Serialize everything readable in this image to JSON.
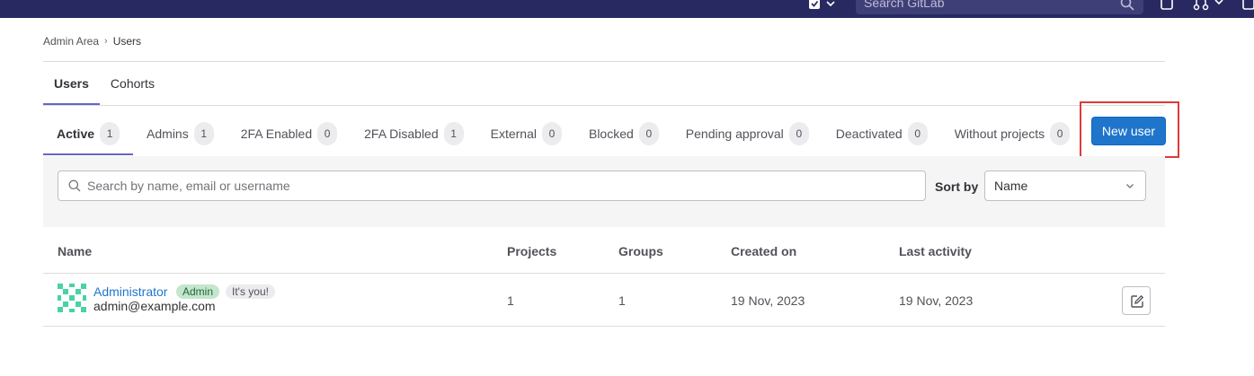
{
  "topbar": {
    "search_placeholder": "Search GitLab",
    "icons": [
      "issues-icon",
      "chevron-down-icon",
      "search-icon",
      "todo-icon",
      "merge-request-icon",
      "chevron-down-icon",
      "user-icon"
    ],
    "bg_color": "#292961"
  },
  "breadcrumb": {
    "parent": "Admin Area",
    "current": "Users"
  },
  "top_tabs": [
    {
      "label": "Users",
      "active": true
    },
    {
      "label": "Cohorts",
      "active": false
    }
  ],
  "filter_tabs": [
    {
      "label": "Active",
      "count": "1",
      "active": true
    },
    {
      "label": "Admins",
      "count": "1"
    },
    {
      "label": "2FA Enabled",
      "count": "0"
    },
    {
      "label": "2FA Disabled",
      "count": "1"
    },
    {
      "label": "External",
      "count": "0"
    },
    {
      "label": "Blocked",
      "count": "0"
    },
    {
      "label": "Pending approval",
      "count": "0"
    },
    {
      "label": "Deactivated",
      "count": "0"
    },
    {
      "label": "Without projects",
      "count": "0"
    }
  ],
  "new_user_button": "New user",
  "filter_bar": {
    "search_placeholder": "Search by name, email or username",
    "sort_label": "Sort by",
    "sort_value": "Name"
  },
  "table": {
    "headers": {
      "name": "Name",
      "projects": "Projects",
      "groups": "Groups",
      "created_on": "Created on",
      "last_activity": "Last activity"
    },
    "rows": [
      {
        "name": "Administrator",
        "admin_badge": "Admin",
        "you_badge": "It's you!",
        "email": "admin@example.com",
        "projects": "1",
        "groups": "1",
        "created_on": "19 Nov, 2023",
        "last_activity": "19 Nov, 2023"
      }
    ]
  },
  "colors": {
    "accent": "#1f75cb",
    "tab_underline": "#6666c4",
    "highlight_box": "#e03a3a",
    "avatar_green": "#4ad2a4"
  }
}
